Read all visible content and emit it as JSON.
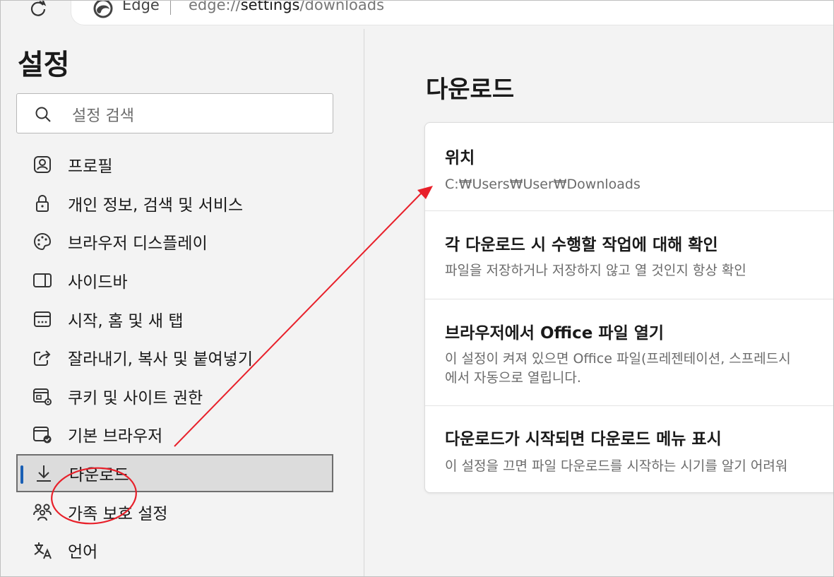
{
  "browser": {
    "name": "Edge",
    "url_prefix": "edge://",
    "url_host": "settings",
    "url_path": "/downloads"
  },
  "sidebar": {
    "title": "설정",
    "search_placeholder": "설정 검색",
    "items": [
      {
        "label": "프로필",
        "icon": "profile-icon"
      },
      {
        "label": "개인 정보, 검색 및 서비스",
        "icon": "lock-icon"
      },
      {
        "label": "브라우저 디스플레이",
        "icon": "palette-icon"
      },
      {
        "label": "사이드바",
        "icon": "sidebar-icon"
      },
      {
        "label": "시작, 홈 및 새 탭",
        "icon": "home-tab-icon"
      },
      {
        "label": "잘라내기, 복사 및 붙여넣기",
        "icon": "share-icon"
      },
      {
        "label": "쿠키 및 사이트 권한",
        "icon": "cookie-settings-icon"
      },
      {
        "label": "기본 브라우저",
        "icon": "default-browser-icon"
      },
      {
        "label": "다운로드",
        "icon": "download-icon",
        "active": true
      },
      {
        "label": "가족 보호 설정",
        "icon": "family-icon"
      },
      {
        "label": "언어",
        "icon": "language-icon"
      }
    ]
  },
  "main": {
    "title": "다운로드",
    "settings": [
      {
        "title": "위치",
        "desc": "C:₩Users₩User₩Downloads"
      },
      {
        "title": "각 다운로드 시 수행할 작업에 대해 확인",
        "desc": "파일을 저장하거나 저장하지 않고 열 것인지 항상 확인"
      },
      {
        "title": "브라우저에서 Office 파일 열기",
        "desc": "이 설정이 켜져 있으면 Office 파일(프레젠테이션, 스프레드시",
        "desc2": "에서 자동으로 열립니다."
      },
      {
        "title": "다운로드가 시작되면 다운로드 메뉴 표시",
        "desc": "이 설정을 끄면 파일 다운로드를 시작하는 시기를 알기 어려워"
      }
    ]
  },
  "colors": {
    "accent": "#1a5fb4",
    "annotation": "#e8202a"
  }
}
